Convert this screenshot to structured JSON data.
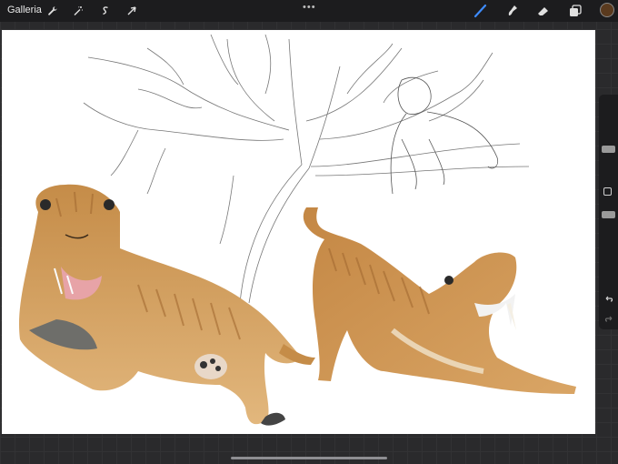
{
  "topbar": {
    "gallery_label": "Galleria",
    "more_label": "•••"
  },
  "tools": {
    "actions": "wrench-icon",
    "adjustments": "magic-wand-icon",
    "selection": "selection-s-icon",
    "transform": "arrow-cursor-icon",
    "brush": "brush-icon",
    "smudge": "smudge-icon",
    "eraser": "eraser-icon",
    "layers": "layers-icon"
  },
  "colors": {
    "active_tool": "#3e8cff",
    "current_color": "#5a3a1e"
  },
  "sidebar": {
    "brush_size": 0.7,
    "opacity": 0.3
  }
}
